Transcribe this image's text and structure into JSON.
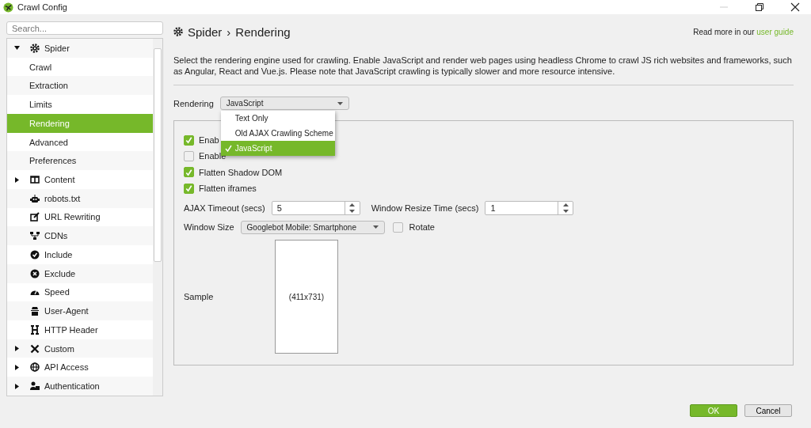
{
  "window": {
    "title": "Crawl Config"
  },
  "sidebar": {
    "search": {
      "placeholder": "Search..."
    },
    "tree": [
      {
        "label": "Spider",
        "kind": "group",
        "expanded": true,
        "selected": false,
        "children": [
          {
            "label": "Crawl",
            "selected": false
          },
          {
            "label": "Extraction",
            "selected": false
          },
          {
            "label": "Limits",
            "selected": false
          },
          {
            "label": "Rendering",
            "selected": true
          },
          {
            "label": "Advanced",
            "selected": false
          },
          {
            "label": "Preferences",
            "selected": false
          }
        ]
      },
      {
        "label": "Content",
        "kind": "group",
        "expanded": false,
        "selected": false
      },
      {
        "label": "robots.txt",
        "kind": "leaf",
        "selected": false
      },
      {
        "label": "URL Rewriting",
        "kind": "leaf",
        "selected": false
      },
      {
        "label": "CDNs",
        "kind": "leaf",
        "selected": false
      },
      {
        "label": "Include",
        "kind": "leaf",
        "selected": false
      },
      {
        "label": "Exclude",
        "kind": "leaf",
        "selected": false
      },
      {
        "label": "Speed",
        "kind": "leaf",
        "selected": false
      },
      {
        "label": "User-Agent",
        "kind": "leaf",
        "selected": false
      },
      {
        "label": "HTTP Header",
        "kind": "leaf",
        "selected": false
      },
      {
        "label": "Custom",
        "kind": "group",
        "expanded": false,
        "selected": false
      },
      {
        "label": "API Access",
        "kind": "group",
        "expanded": false,
        "selected": false
      },
      {
        "label": "Authentication",
        "kind": "group",
        "expanded": false,
        "selected": false
      }
    ]
  },
  "header": {
    "title": "Spider",
    "separator": "›",
    "subtitle": "Rendering",
    "help_text": "Read more in our",
    "help_link": "user guide"
  },
  "description": "Select the rendering engine used for crawling. Enable JavaScript and render web pages using headless Chrome to crawl JS rich websites and frameworks, such as Angular, React and Vue.js. Please note that JavaScript crawling is typically slower and more resource intensive.",
  "rendering": {
    "label": "Rendering",
    "value": "JavaScript",
    "menu": [
      {
        "label": "Text Only",
        "selected": false
      },
      {
        "label": "Old AJAX Crawling Scheme",
        "selected": false
      },
      {
        "label": "JavaScript",
        "selected": true
      }
    ]
  },
  "options": [
    {
      "label": "Enab",
      "checked": true
    },
    {
      "label": "Enable",
      "checked": false
    },
    {
      "label": "Flatten Shadow DOM",
      "checked": true
    },
    {
      "label": "Flatten iframes",
      "checked": true
    }
  ],
  "ajax_timeout": {
    "label": "AJAX Timeout (secs)",
    "value": "5"
  },
  "window_resize_time": {
    "label": "Window Resize Time (secs)",
    "value": "1"
  },
  "window_size": {
    "label": "Window Size",
    "value": "Googlebot Mobile: Smartphone"
  },
  "rotate": {
    "label": "Rotate",
    "checked": false
  },
  "sample": {
    "label": "Sample",
    "size": "(411x731)"
  },
  "buttons": [
    {
      "label": "OK",
      "kind": "primary"
    },
    {
      "label": "Cancel",
      "kind": "secondary"
    }
  ]
}
